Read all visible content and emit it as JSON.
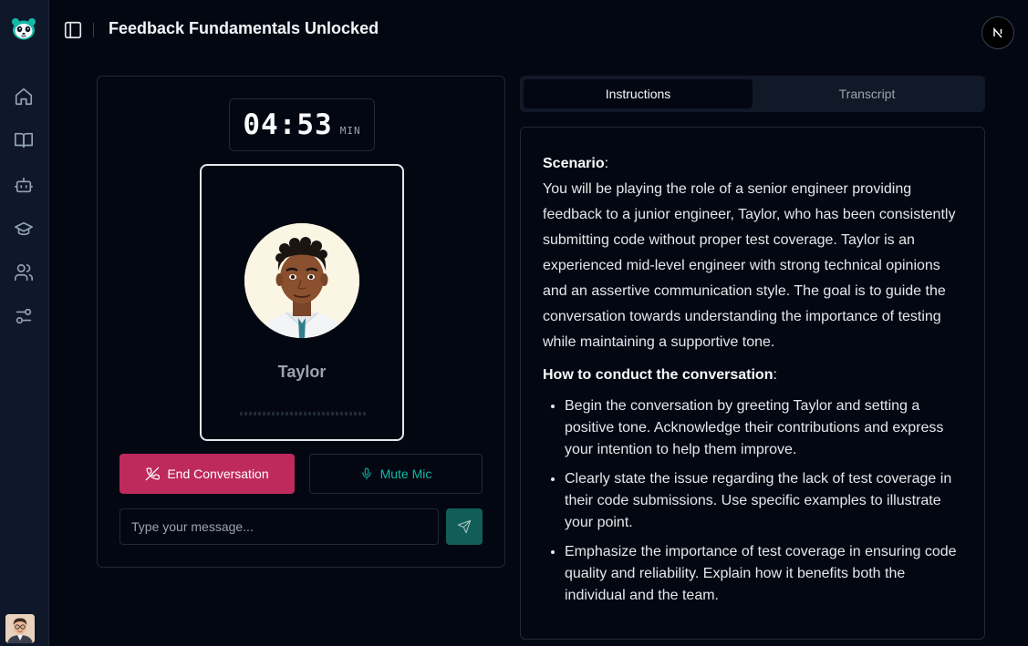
{
  "app": {
    "title": "Feedback Fundamentals Unlocked"
  },
  "sidebar": {
    "items": [
      {
        "name": "home",
        "icon": "home-icon"
      },
      {
        "name": "library",
        "icon": "book-open-icon"
      },
      {
        "name": "bots",
        "icon": "bot-icon"
      },
      {
        "name": "learning",
        "icon": "graduation-cap-icon"
      },
      {
        "name": "users",
        "icon": "users-icon"
      },
      {
        "name": "settings",
        "icon": "sliders-icon"
      }
    ]
  },
  "timer": {
    "value": "04:53",
    "unit": "MIN"
  },
  "persona": {
    "name": "Taylor"
  },
  "actions": {
    "end_label": "End Conversation",
    "mute_label": "Mute Mic"
  },
  "message": {
    "placeholder": "Type your message...",
    "value": ""
  },
  "tabs": [
    {
      "label": "Instructions",
      "active": true
    },
    {
      "label": "Transcript",
      "active": false
    }
  ],
  "instructions": {
    "scenario_heading": "Scenario",
    "scenario_text": "You will be playing the role of a senior engineer providing feedback to a junior engineer, Taylor, who has been consistently submitting code without proper test coverage. Taylor is an experienced mid-level engineer with strong technical opinions and an assertive communication style. The goal is to guide the conversation towards understanding the importance of testing while maintaining a supportive tone.",
    "howto_heading": "How to conduct the conversation",
    "steps": [
      "Begin the conversation by greeting Taylor and setting a positive tone. Acknowledge their contributions and express your intention to help them improve.",
      "Clearly state the issue regarding the lack of test coverage in their code submissions. Use specific examples to illustrate your point.",
      "Emphasize the importance of test coverage in ensuring code quality and reliability. Explain how it benefits both the individual and the team."
    ]
  },
  "colors": {
    "background": "#030712",
    "sidebar": "#0f172a",
    "danger": "#be2a5c",
    "accent": "#14b8a6",
    "send": "#115e59"
  }
}
